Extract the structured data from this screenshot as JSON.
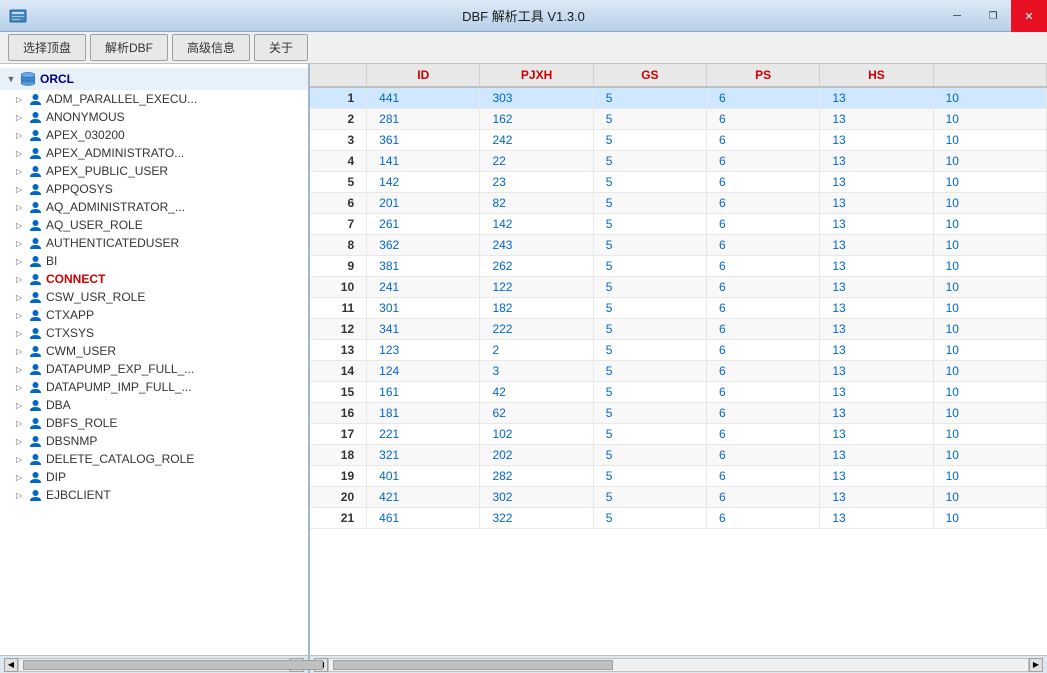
{
  "window": {
    "title": "DBF 解析工具 V1.3.0",
    "controls": {
      "minimize": "─",
      "restore": "❐",
      "close": "✕"
    }
  },
  "menu": {
    "tabs": [
      "选择顶盘",
      "解析DBF",
      "高级信息",
      "关于"
    ]
  },
  "tree": {
    "root_label": "ORCL",
    "items": [
      {
        "label": "ADM_PARALLEL_EXECU...",
        "type": "user"
      },
      {
        "label": "ANONYMOUS",
        "type": "user"
      },
      {
        "label": "APEX_030200",
        "type": "user"
      },
      {
        "label": "APEX_ADMINISTRATO...",
        "type": "user"
      },
      {
        "label": "APEX_PUBLIC_USER",
        "type": "user"
      },
      {
        "label": "APPQOSYS",
        "type": "user"
      },
      {
        "label": "AQ_ADMINISTRATOR_...",
        "type": "user"
      },
      {
        "label": "AQ_USER_ROLE",
        "type": "user"
      },
      {
        "label": "AUTHENTICATEDUSER",
        "type": "user"
      },
      {
        "label": "BI",
        "type": "user"
      },
      {
        "label": "CONNECT",
        "type": "user",
        "special": true
      },
      {
        "label": "CSW_USR_ROLE",
        "type": "user"
      },
      {
        "label": "CTXAPP",
        "type": "user"
      },
      {
        "label": "CTXSYS",
        "type": "user"
      },
      {
        "label": "CWM_USER",
        "type": "user"
      },
      {
        "label": "DATAPUMP_EXP_FULL_...",
        "type": "user"
      },
      {
        "label": "DATAPUMP_IMP_FULL_...",
        "type": "user"
      },
      {
        "label": "DBA",
        "type": "user"
      },
      {
        "label": "DBFS_ROLE",
        "type": "user"
      },
      {
        "label": "DBSNMP",
        "type": "user"
      },
      {
        "label": "DELETE_CATALOG_ROLE",
        "type": "user"
      },
      {
        "label": "DIP",
        "type": "user"
      },
      {
        "label": "EJBCLIENT",
        "type": "user"
      }
    ]
  },
  "table": {
    "columns": [
      "",
      "ID",
      "PJXH",
      "GS",
      "PS",
      "HS"
    ],
    "rows": [
      {
        "row": 1,
        "id": 441,
        "pjxh": 303,
        "gs": 5,
        "ps": 6,
        "hs": 13,
        "extra": 10,
        "selected": true
      },
      {
        "row": 2,
        "id": 281,
        "pjxh": 162,
        "gs": 5,
        "ps": 6,
        "hs": 13,
        "extra": 10
      },
      {
        "row": 3,
        "id": 361,
        "pjxh": 242,
        "gs": 5,
        "ps": 6,
        "hs": 13,
        "extra": 10
      },
      {
        "row": 4,
        "id": 141,
        "pjxh": 22,
        "gs": 5,
        "ps": 6,
        "hs": 13,
        "extra": 10
      },
      {
        "row": 5,
        "id": 142,
        "pjxh": 23,
        "gs": 5,
        "ps": 6,
        "hs": 13,
        "extra": 10
      },
      {
        "row": 6,
        "id": 201,
        "pjxh": 82,
        "gs": 5,
        "ps": 6,
        "hs": 13,
        "extra": 10
      },
      {
        "row": 7,
        "id": 261,
        "pjxh": 142,
        "gs": 5,
        "ps": 6,
        "hs": 13,
        "extra": 10
      },
      {
        "row": 8,
        "id": 362,
        "pjxh": 243,
        "gs": 5,
        "ps": 6,
        "hs": 13,
        "extra": 10
      },
      {
        "row": 9,
        "id": 381,
        "pjxh": 262,
        "gs": 5,
        "ps": 6,
        "hs": 13,
        "extra": 10
      },
      {
        "row": 10,
        "id": 241,
        "pjxh": 122,
        "gs": 5,
        "ps": 6,
        "hs": 13,
        "extra": 10
      },
      {
        "row": 11,
        "id": 301,
        "pjxh": 182,
        "gs": 5,
        "ps": 6,
        "hs": 13,
        "extra": 10
      },
      {
        "row": 12,
        "id": 341,
        "pjxh": 222,
        "gs": 5,
        "ps": 6,
        "hs": 13,
        "extra": 10
      },
      {
        "row": 13,
        "id": 123,
        "pjxh": 2,
        "gs": 5,
        "ps": 6,
        "hs": 13,
        "extra": 10
      },
      {
        "row": 14,
        "id": 124,
        "pjxh": 3,
        "gs": 5,
        "ps": 6,
        "hs": 13,
        "extra": 10
      },
      {
        "row": 15,
        "id": 161,
        "pjxh": 42,
        "gs": 5,
        "ps": 6,
        "hs": 13,
        "extra": 10
      },
      {
        "row": 16,
        "id": 181,
        "pjxh": 62,
        "gs": 5,
        "ps": 6,
        "hs": 13,
        "extra": 10
      },
      {
        "row": 17,
        "id": 221,
        "pjxh": 102,
        "gs": 5,
        "ps": 6,
        "hs": 13,
        "extra": 10
      },
      {
        "row": 18,
        "id": 321,
        "pjxh": 202,
        "gs": 5,
        "ps": 6,
        "hs": 13,
        "extra": 10
      },
      {
        "row": 19,
        "id": 401,
        "pjxh": 282,
        "gs": 5,
        "ps": 6,
        "hs": 13,
        "extra": 10
      },
      {
        "row": 20,
        "id": 421,
        "pjxh": 302,
        "gs": 5,
        "ps": 6,
        "hs": 13,
        "extra": 10
      },
      {
        "row": 21,
        "id": 461,
        "pjxh": 322,
        "gs": 5,
        "ps": 6,
        "hs": 13,
        "extra": 10
      }
    ]
  }
}
